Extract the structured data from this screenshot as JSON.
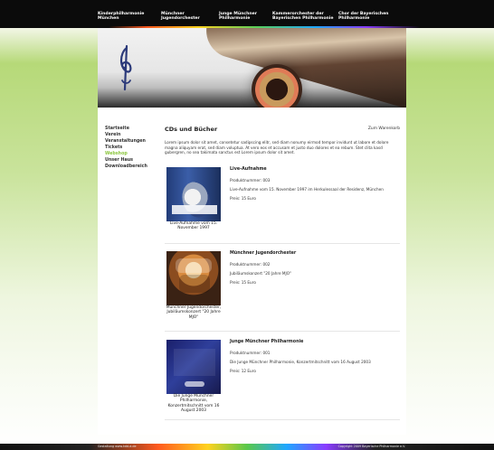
{
  "nav": [
    {
      "label": "Kinderphilharmonie\nMünchen"
    },
    {
      "label": "Münchner\nJugendorchester"
    },
    {
      "label": "Junge Münchner\nPhilharmonie"
    },
    {
      "label": "Kammerorchester der\nBayerischen Philharmonie"
    },
    {
      "label": "Chor der Bayerischen\nPhilharmonie"
    }
  ],
  "sidebar": {
    "items": [
      {
        "label": "Startseite"
      },
      {
        "label": "Verein"
      },
      {
        "label": "Veranstaltungen"
      },
      {
        "label": "Tickets"
      },
      {
        "label": "Webshop"
      },
      {
        "label": "Unser Haus"
      },
      {
        "label": "Downloadbereich"
      }
    ]
  },
  "main": {
    "title": "CDs und Bücher",
    "cart_link": "Zum Warenkorb",
    "intro": "Lorem ipsum dolor sit amet, consetetur sadipscing elitr, sed diam nonumy eirmod tempor invidunt ut labore et dolore magna aliquyam erat, sed diam voluptua. At vero eos et accusam et justo duo dolores et ea rebum. Stet clita kasd gubergren, no sea takimata sanctus est Lorem ipsum dolor sit amet.",
    "products": [
      {
        "title": "Live-Aufnahme",
        "product_number": "Produktnummer: 003",
        "description": "Live-Aufnahme vom 15. November 1997 im Herkulessaal der Residenz, München",
        "price": "Preis: 15 Euro",
        "caption": "Live-Aufnahme vom 15. November 1997"
      },
      {
        "title": "Münchner Jugendorchester",
        "product_number": "Produktnummer: 002",
        "description": "Jubiläumskonzert \"20 Jahre MJO\"",
        "price": "Preis: 15 Euro",
        "caption": "Münchner Jugendorchester, Jubiläumskonzert \"20 Jahre MJO\""
      },
      {
        "title": "Junge Münchner Philharmonie",
        "product_number": "Produktnummer: 001",
        "description": "Die Junge Münchner Philharmonie, Konzertmitschnitt vom 16 August 2003",
        "price": "Preis: 12 Euro",
        "caption": "Die Junge Münchner Philharmonie, Konzertmitschnitt vom 16 August 2003"
      }
    ]
  },
  "footer": {
    "left": "Gestaltung www.kdd-d.de",
    "right": "Copyright 2009 Bayerische Philharmonie e.V."
  },
  "colors": {
    "accent_green": "#8cc63f",
    "topbar": "#0b0b0b",
    "footer": "#111111"
  },
  "icons": {
    "logo": "clef-logo-icon"
  }
}
